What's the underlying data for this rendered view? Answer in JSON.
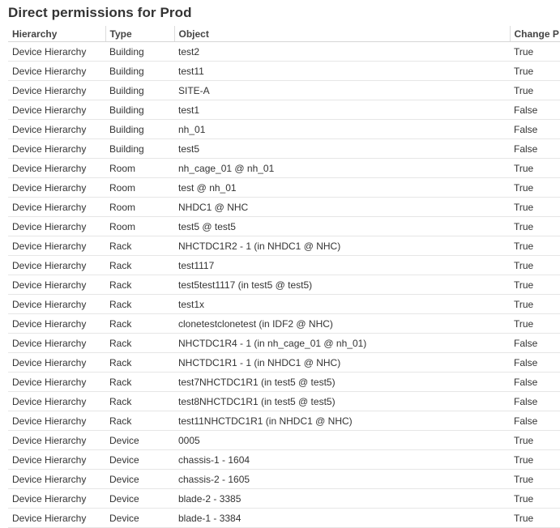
{
  "page": {
    "title": "Direct permissions for Prod"
  },
  "table": {
    "headers": [
      "Hierarchy",
      "Type",
      "Object",
      "Change P"
    ],
    "rows": [
      [
        "Device Hierarchy",
        "Building",
        "test2",
        "True"
      ],
      [
        "Device Hierarchy",
        "Building",
        "test11",
        "True"
      ],
      [
        "Device Hierarchy",
        "Building",
        "SITE-A",
        "True"
      ],
      [
        "Device Hierarchy",
        "Building",
        "test1",
        "False"
      ],
      [
        "Device Hierarchy",
        "Building",
        "nh_01",
        "False"
      ],
      [
        "Device Hierarchy",
        "Building",
        "test5",
        "False"
      ],
      [
        "Device Hierarchy",
        "Room",
        "nh_cage_01 @ nh_01",
        "True"
      ],
      [
        "Device Hierarchy",
        "Room",
        "test @ nh_01",
        "True"
      ],
      [
        "Device Hierarchy",
        "Room",
        "NHDC1 @ NHC",
        "True"
      ],
      [
        "Device Hierarchy",
        "Room",
        "test5 @ test5",
        "True"
      ],
      [
        "Device Hierarchy",
        "Rack",
        "NHCTDC1R2 - 1 (in NHDC1 @ NHC)",
        "True"
      ],
      [
        "Device Hierarchy",
        "Rack",
        "test1117",
        "True"
      ],
      [
        "Device Hierarchy",
        "Rack",
        "test5test1117 (in test5 @ test5)",
        "True"
      ],
      [
        "Device Hierarchy",
        "Rack",
        "test1x",
        "True"
      ],
      [
        "Device Hierarchy",
        "Rack",
        "clonetestclonetest (in IDF2 @ NHC)",
        "True"
      ],
      [
        "Device Hierarchy",
        "Rack",
        "NHCTDC1R4 - 1 (in nh_cage_01 @ nh_01)",
        "False"
      ],
      [
        "Device Hierarchy",
        "Rack",
        "NHCTDC1R1 - 1 (in NHDC1 @ NHC)",
        "False"
      ],
      [
        "Device Hierarchy",
        "Rack",
        "test7NHCTDC1R1 (in test5 @ test5)",
        "False"
      ],
      [
        "Device Hierarchy",
        "Rack",
        "test8NHCTDC1R1 (in test5 @ test5)",
        "False"
      ],
      [
        "Device Hierarchy",
        "Rack",
        "test11NHCTDC1R1 (in NHDC1 @ NHC)",
        "False"
      ],
      [
        "Device Hierarchy",
        "Device",
        "0005",
        "True"
      ],
      [
        "Device Hierarchy",
        "Device",
        "chassis-1 - 1604",
        "True"
      ],
      [
        "Device Hierarchy",
        "Device",
        "chassis-2 - 1605",
        "True"
      ],
      [
        "Device Hierarchy",
        "Device",
        "blade-2 - 3385",
        "True"
      ],
      [
        "Device Hierarchy",
        "Device",
        "blade-1 - 3384",
        "True"
      ]
    ]
  }
}
